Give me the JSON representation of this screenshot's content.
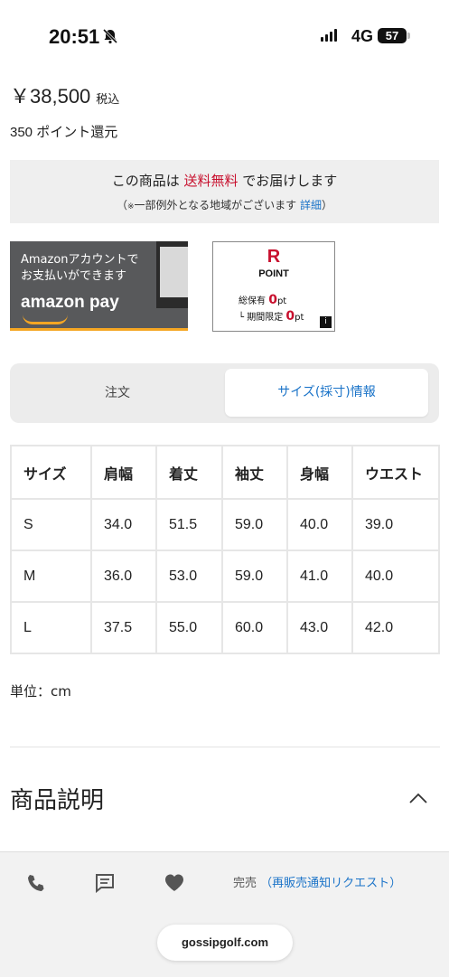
{
  "status_bar": {
    "time": "20:51",
    "network": "4G",
    "battery": "57"
  },
  "product": {
    "price": "￥38,500",
    "tax": "税込",
    "points": "350 ポイント還元"
  },
  "shipping": {
    "prefix": "この商品は",
    "highlight": "送料無料",
    "suffix": "でお届けします",
    "note_prefix": "（",
    "note_mark": "※",
    "note_text": "一部例外となる地域がございます",
    "detail_link": "詳細",
    "note_suffix": "）"
  },
  "amazon_banner": {
    "line1": "Amazonアカウントで",
    "line2": "お支払いができます",
    "pay_label": "amazon pay"
  },
  "rakuten_point": {
    "logo": "R",
    "title": "POINT",
    "held_label": "総保有",
    "held_value": "0",
    "held_unit": "pt",
    "limited_label": "└ 期間限定",
    "limited_value": "0",
    "limited_unit": "pt",
    "info_icon": "i"
  },
  "tabs": {
    "order": "注文",
    "size": "サイズ(採寸)情報",
    "active": "size"
  },
  "size_table": {
    "headers": [
      "サイズ",
      "肩幅",
      "着丈",
      "袖丈",
      "身幅",
      "ウエスト"
    ],
    "rows": [
      [
        "S",
        "34.0",
        "51.5",
        "59.0",
        "40.0",
        "39.0"
      ],
      [
        "M",
        "36.0",
        "53.0",
        "59.0",
        "41.0",
        "40.0"
      ],
      [
        "L",
        "37.5",
        "55.0",
        "60.0",
        "43.0",
        "42.0"
      ]
    ]
  },
  "unit_label": "単位：cm",
  "description_section": {
    "title": "商品説明",
    "expanded": true
  },
  "bottom_bar": {
    "sold_out": "完売",
    "restock_open": "（",
    "restock_link": "再販売通知リクエスト",
    "restock_close": "）",
    "icons": [
      "phone-icon",
      "chat-icon",
      "heart-icon"
    ]
  },
  "browser": {
    "url": "gossipgolf.com"
  },
  "colors": {
    "accent_red": "#c8102e",
    "link_blue": "#1a73c8",
    "amazon_orange": "#f5a623"
  }
}
